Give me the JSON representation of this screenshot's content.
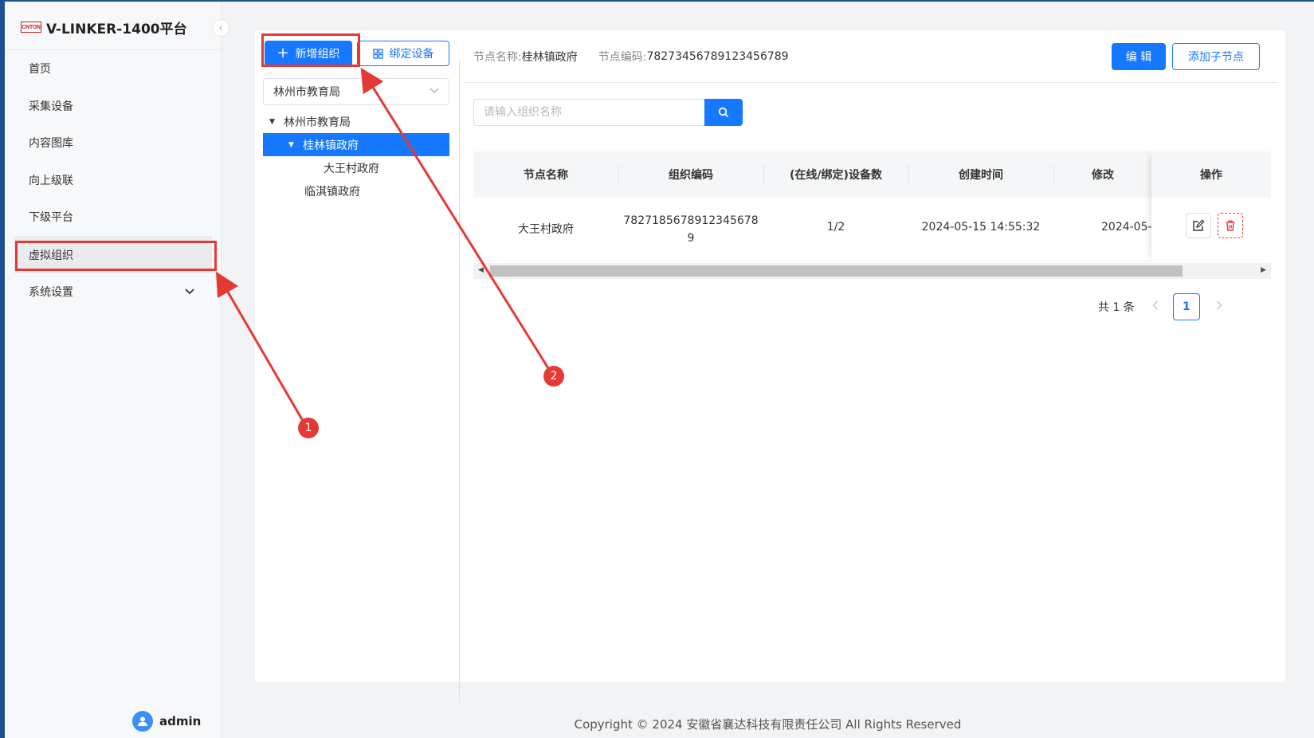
{
  "app": {
    "logo_text": "CNTON",
    "title": "V-LINKER-1400平台"
  },
  "sidebar": {
    "items": [
      {
        "label": "首页"
      },
      {
        "label": "采集设备"
      },
      {
        "label": "内容图库"
      },
      {
        "label": "向上级联"
      },
      {
        "label": "下级平台"
      },
      {
        "label": "虚拟组织"
      },
      {
        "label": "系统设置"
      }
    ],
    "active": "虚拟组织",
    "user": "admin"
  },
  "toolbar": {
    "add_org_label": "新增组织",
    "bind_device_label": "绑定设备"
  },
  "org_select": {
    "value": "林州市教育局"
  },
  "tree": {
    "nodes": [
      {
        "label": "林州市教育局"
      },
      {
        "label": "桂林镇政府"
      },
      {
        "label": "大王村政府"
      },
      {
        "label": "临淇镇政府"
      }
    ],
    "selected": "桂林镇政府"
  },
  "node_info": {
    "name_label": "节点名称:",
    "name_value": "桂林镇政府",
    "code_label": "节点编码:",
    "code_value": "78273456789123456789",
    "edit_label": "编 辑",
    "add_child_label": "添加子节点"
  },
  "search": {
    "placeholder": "请输入组织名称"
  },
  "table": {
    "columns": [
      "节点名称",
      "组织编码",
      "(在线/绑定)设备数",
      "创建时间",
      "修改",
      "操作"
    ],
    "rows": [
      {
        "name": "大王村政府",
        "code_line1": "7827185678912345678",
        "code_line2": "9",
        "devices": "1/2",
        "created": "2024-05-15 14:55:32",
        "modified": "2024-05-"
      }
    ]
  },
  "pagination": {
    "total": "共 1 条",
    "current": "1"
  },
  "footer": {
    "copyright": "Copyright © 2024 安徽省襄达科技有限责任公司 All Rights Reserved"
  },
  "annotations": {
    "marker1": "1",
    "marker2": "2"
  },
  "colors": {
    "primary": "#1677ff",
    "annotation": "#e53935",
    "frame": "#1e4f91"
  }
}
